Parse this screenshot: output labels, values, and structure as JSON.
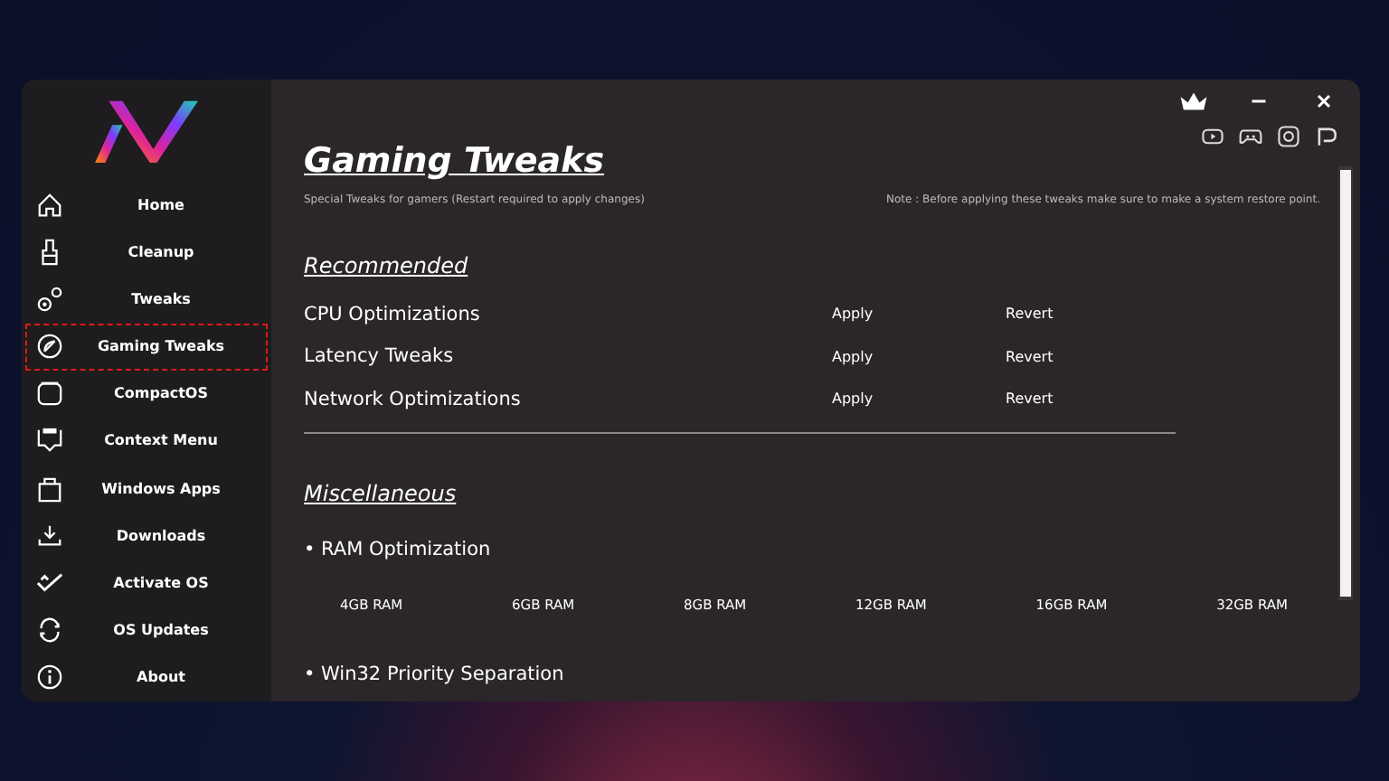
{
  "sidebar": {
    "items": [
      {
        "label": "Home",
        "selected": false
      },
      {
        "label": "Cleanup",
        "selected": false
      },
      {
        "label": "Tweaks",
        "selected": false
      },
      {
        "label": "Gaming Tweaks",
        "selected": true
      },
      {
        "label": "CompactOS",
        "selected": false
      },
      {
        "label": "Context Menu",
        "selected": false
      },
      {
        "label": "Windows Apps",
        "selected": false
      },
      {
        "label": "Downloads",
        "selected": false
      },
      {
        "label": "Activate OS",
        "selected": false
      },
      {
        "label": "OS Updates",
        "selected": false
      },
      {
        "label": "About",
        "selected": false
      }
    ]
  },
  "page": {
    "title": "Gaming Tweaks",
    "subtitle": "Special Tweaks for gamers (Restart required to apply changes)",
    "note": "Note : Before applying these tweaks make sure to make a system restore point."
  },
  "recommended": {
    "heading": "Recommended",
    "rows": [
      {
        "label": "CPU Optimizations",
        "apply": "Apply",
        "revert": "Revert"
      },
      {
        "label": "Latency Tweaks",
        "apply": "Apply",
        "revert": "Revert"
      },
      {
        "label": "Network Optimizations",
        "apply": "Apply",
        "revert": "Revert"
      }
    ]
  },
  "miscellaneous": {
    "heading": "Miscellaneous",
    "ram_title": "• RAM Optimization",
    "ram_options": [
      "4GB RAM",
      "6GB RAM",
      "8GB RAM",
      "12GB RAM",
      "16GB RAM",
      "32GB RAM"
    ],
    "priority_title": "• Win32 Priority Separation"
  }
}
